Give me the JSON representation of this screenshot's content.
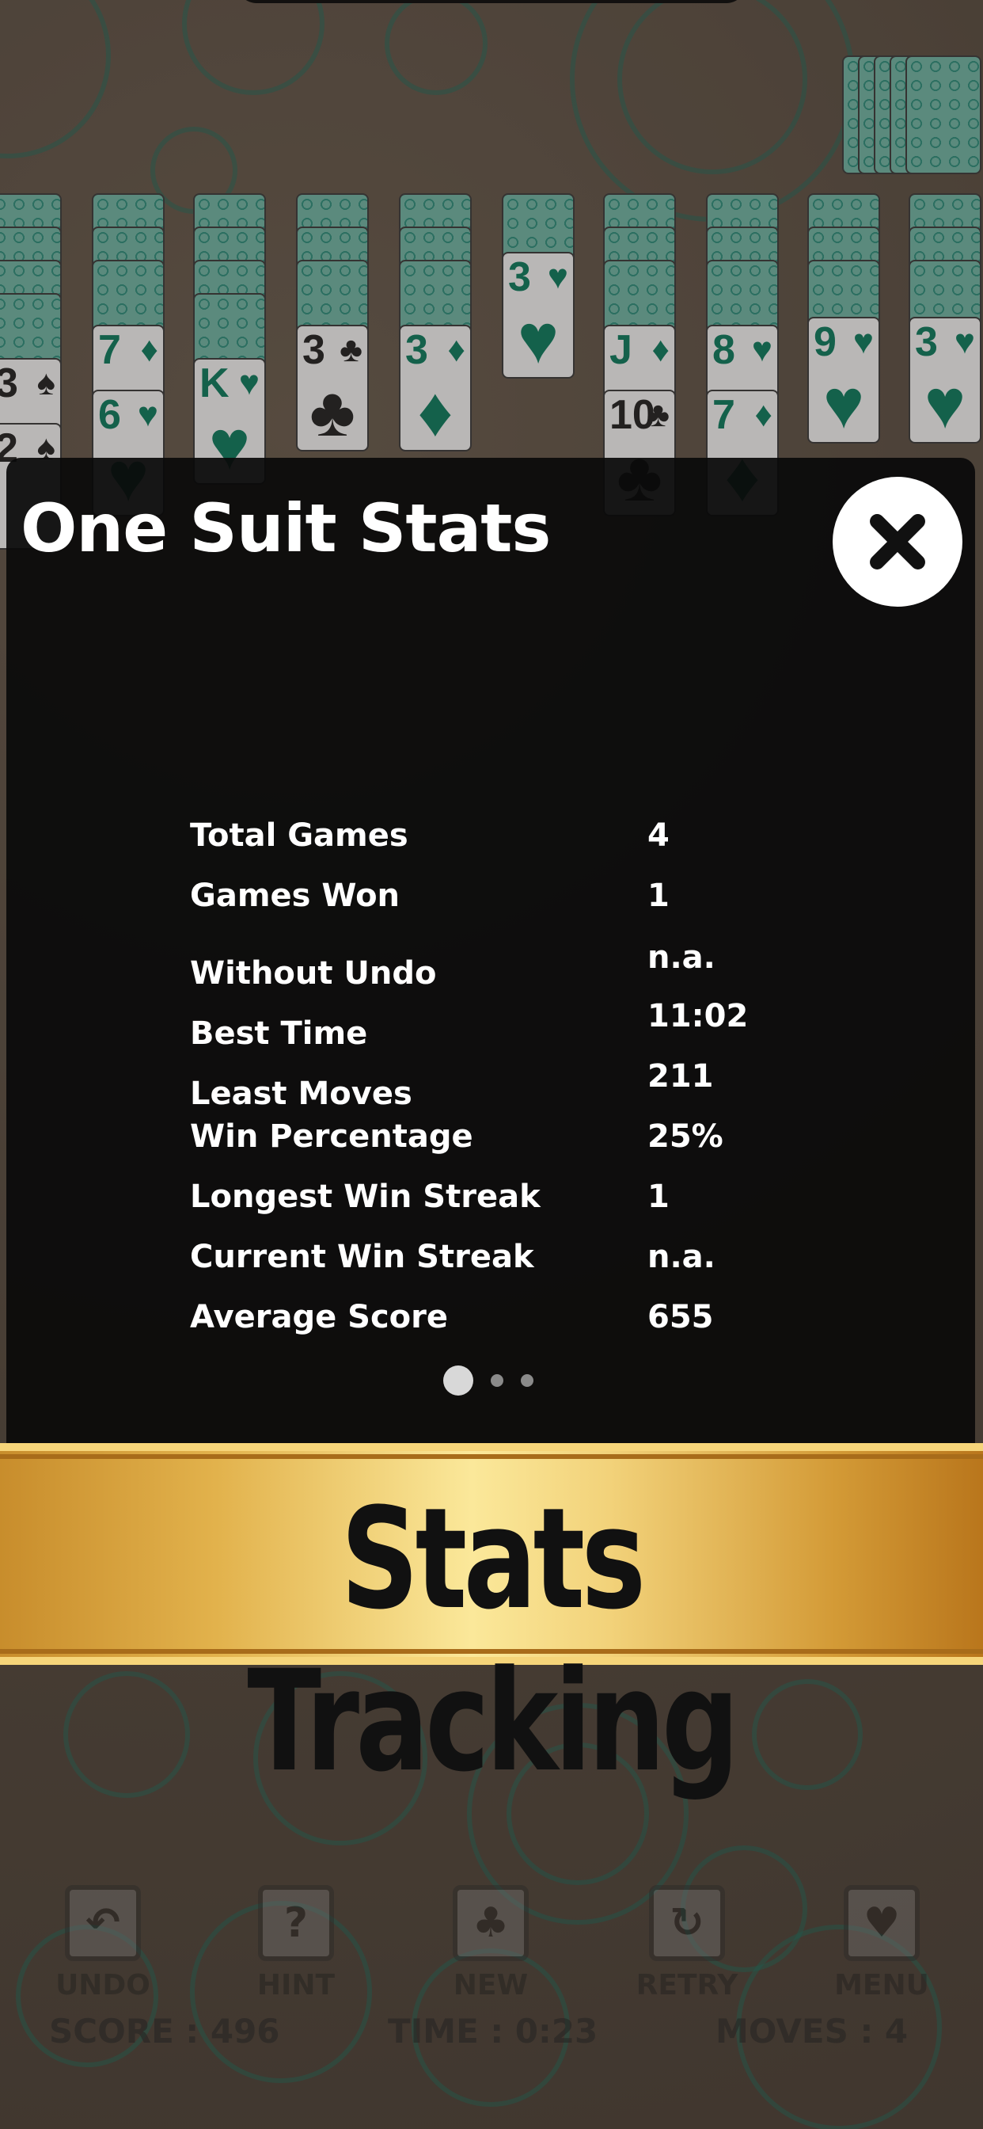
{
  "modal": {
    "title": "One Suit Stats",
    "close_icon": "close-icon",
    "stats": [
      {
        "label": "Total Games",
        "value": "4"
      },
      {
        "label": "Games Won",
        "value": "1"
      },
      {
        "label": "Without Undo",
        "value": "n.a."
      },
      {
        "label": "Best Time",
        "value": "11:02"
      },
      {
        "label": "Least Moves",
        "value": "211"
      },
      {
        "label": "Win Percentage",
        "value": "25%"
      },
      {
        "label": "Longest Win Streak",
        "value": "1"
      },
      {
        "label": "Current Win Streak",
        "value": "n.a."
      },
      {
        "label": "Average Score",
        "value": "655"
      }
    ],
    "page_indicator": {
      "pages": 3,
      "current": 1
    }
  },
  "banner": {
    "text": "Stats Tracking"
  },
  "toolbar": {
    "undo": {
      "label": "UNDO",
      "icon": "undo-icon"
    },
    "hint": {
      "label": "HINT",
      "icon": "hint-icon"
    },
    "new": {
      "label": "NEW",
      "icon": "new-game-icon"
    },
    "retry": {
      "label": "RETRY",
      "icon": "retry-icon"
    },
    "menu": {
      "label": "MENU",
      "icon": "menu-icon"
    }
  },
  "status": {
    "score": "SCORE : 496",
    "time": "TIME : 0:23",
    "moves": "MOVES : 4"
  },
  "tableau_visible_cards": [
    {
      "rank": "7",
      "suit": "♦"
    },
    {
      "rank": "6",
      "suit": "♥"
    },
    {
      "rank": "K",
      "suit": "♥"
    },
    {
      "rank": "3",
      "suit": "♣"
    },
    {
      "rank": "3",
      "suit": "♦"
    },
    {
      "rank": "3",
      "suit": "♥"
    },
    {
      "rank": "J",
      "suit": "♦"
    },
    {
      "rank": "10",
      "suit": "♣"
    },
    {
      "rank": "8",
      "suit": "♥"
    },
    {
      "rank": "7",
      "suit": "♦"
    },
    {
      "rank": "9",
      "suit": "♥"
    },
    {
      "rank": "3",
      "suit": "♥"
    },
    {
      "rank": "3",
      "suit": "♠"
    },
    {
      "rank": "2",
      "suit": "♠"
    }
  ],
  "colors": {
    "felt": "#5b5044",
    "card_green": "#0d7a5e",
    "card_back": "#6fb3a2",
    "modal_bg": "#0a0a0a",
    "banner_gold": "#e2b24c"
  }
}
